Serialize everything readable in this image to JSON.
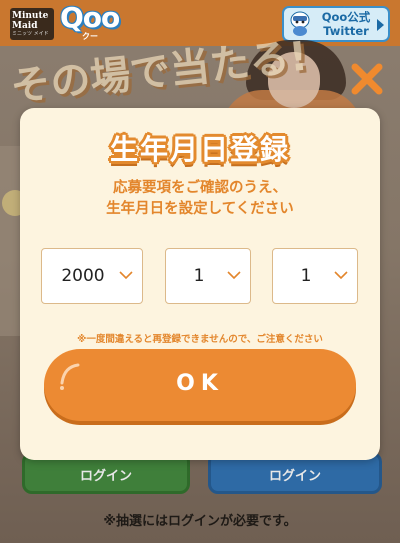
{
  "header": {
    "brand_line1": "Minute",
    "brand_line2": "Maid",
    "brand_line3": "ミニッツ メイド",
    "product_logo": "Qoo",
    "product_kana": "クー",
    "twitter_button": "Qoo公式\nTwitter",
    "twitter_line1": "Qoo公式",
    "twitter_line2": "Twitter"
  },
  "background": {
    "banner_text": "その場で当たる!",
    "login_left": "ログイン",
    "login_right": "ログイン",
    "notice": "※抽選にはログインが必要です。"
  },
  "modal": {
    "title": "生年月日登録",
    "instruction_line1": "応募要項をご確認のうえ、",
    "instruction_line2": "生年月日を設定してください",
    "year_value": "2000",
    "month_value": "1",
    "day_value": "1",
    "warning": "※一度間違えると再登録できませんので、ご注意ください",
    "ok_label": "OK"
  },
  "icons": {
    "close": "close-x-icon",
    "dropdown": "chevron-down-icon",
    "twitter_arrow": "arrow-right-icon"
  },
  "colors": {
    "accent_orange": "#ec8a33",
    "modal_bg": "#fdf4df",
    "header_bg": "#c9772f",
    "twitter_blue": "#1b6aa5"
  }
}
